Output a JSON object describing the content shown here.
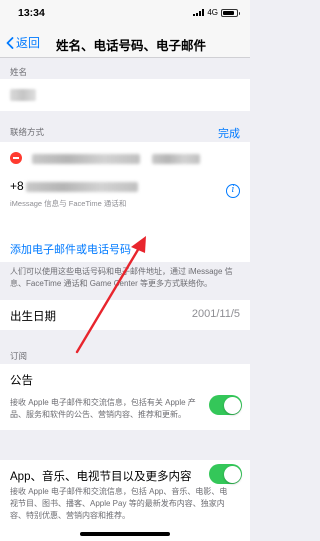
{
  "status_bar": {
    "time": "13:34",
    "network": "4G"
  },
  "nav": {
    "back_label": "返回",
    "title": "姓名、电话号码、电子邮件"
  },
  "name_section": {
    "header": "姓名"
  },
  "contact_section": {
    "header": "联络方式",
    "done_label": "完成",
    "phone_prefix": "+8",
    "phone_sub": "iMessage 信息与 FaceTime 通话和",
    "add_link": "添加电子邮件或电话号码",
    "footnote": "人们可以使用这些电话号码和电子邮件地址，通过 iMessage 信息、FaceTime 通话和 Game Center 等更多方式联络你。"
  },
  "birthday": {
    "label": "出生日期",
    "value": "2001/11/5"
  },
  "subscription_section": {
    "header": "订阅",
    "announcements_label": "公告",
    "announcements_note": "接收 Apple 电子邮件和交流信息，包括有关 Apple 产品、服务和软件的公告、营销内容、推荐和更新。",
    "media_label": "App、音乐、电视节目以及更多内容",
    "media_note": "接收 Apple 电子邮件和交流信息，包括 App、音乐、电影、电视节目、图书、播客、Apple Pay 等的最新发布内容、独家内容、特别优惠、营销内容和推荐。"
  },
  "colors": {
    "accent": "#007aff",
    "switch_on": "#34c759",
    "destructive": "#ff3b30",
    "annotation": "#e8252d"
  }
}
